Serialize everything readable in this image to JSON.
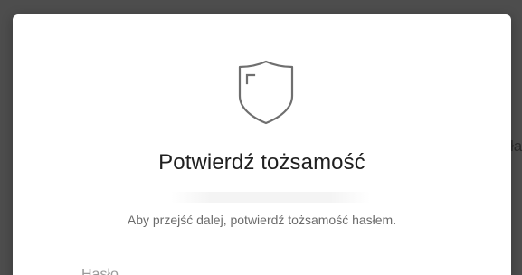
{
  "background": {
    "peek_text": "ła"
  },
  "dialog": {
    "icon": "shield-icon",
    "title": "Potwierdź tożsamość",
    "description": "Aby przejść dalej, potwierdź tożsamość hasłem.",
    "password_label": "Hasło"
  },
  "colors": {
    "overlay": "#4d4d4d",
    "dialog_bg": "#ffffff",
    "title": "#1f1f1f",
    "description": "#6b6b6b",
    "icon_stroke": "#6f6f6f"
  }
}
